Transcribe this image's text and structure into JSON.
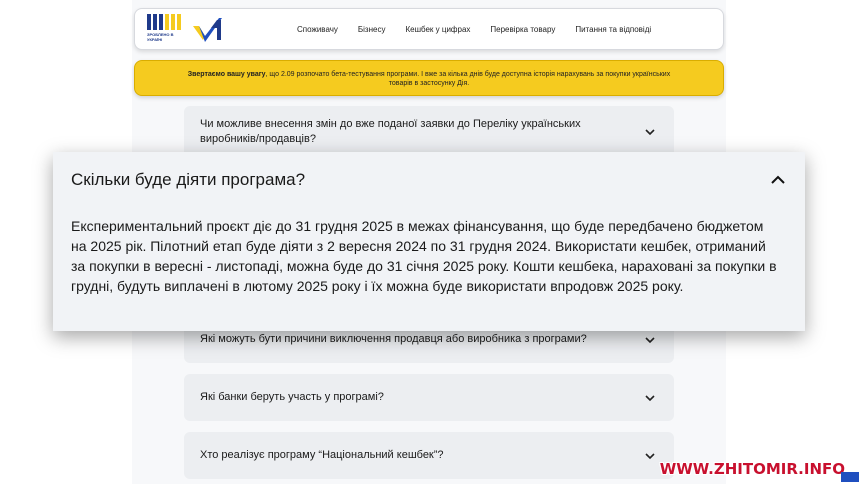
{
  "header": {
    "logo_text": "ЗРОБЛЕНО В УКРАЇНІ",
    "nav": [
      {
        "label": "Споживачу"
      },
      {
        "label": "Бізнесу"
      },
      {
        "label": "Кешбек у цифрах"
      },
      {
        "label": "Перевірка товару"
      },
      {
        "label": "Питання та відповіді"
      }
    ]
  },
  "notice": {
    "bold": "Звертаємо вашу увагу",
    "text": ", що 2.09 розпочато бета-тестування програми. І вже за кілька днів буде доступна історія нарахувань за покупки українських товарів в застосунку Дія."
  },
  "faq": {
    "item_1": "Чи можливе внесення змін до вже поданої заявки до Переліку українських виробників/продавців?",
    "item_open_title": "Скільки буде діяти програма?",
    "item_open_body": "Експериментальний проєкт діє до 31 грудня 2025 в межах фінансування, що буде передбачено бюджетом на 2025 рік. Пілотний етап буде діяти з 2 вересня 2024 по 31 грудня 2024. Використати кешбек, отриманий за покупки в вересні - листопаді, можна буде до 31 січня 2025 року. Кошти кешбека, нараховані за покупки в грудні, будуть виплачені в лютому 2025 року і їх можна буде використати впродовж 2025 року.",
    "item_3": "Які можуть бути причини виключення продавця або виробника з програми?",
    "item_4": "Які банки беруть участь у програмі?",
    "item_5": "Хто реалізує програму “Національний кешбек”?"
  },
  "watermark": "WWW.ZHITOMIR.INFO",
  "colors": {
    "notice_bg": "#f5cb1f",
    "card_bg": "#eceef1",
    "watermark": "#c8102e",
    "brand_blue": "#1f3a8a",
    "brand_yellow": "#f5cb1f"
  }
}
